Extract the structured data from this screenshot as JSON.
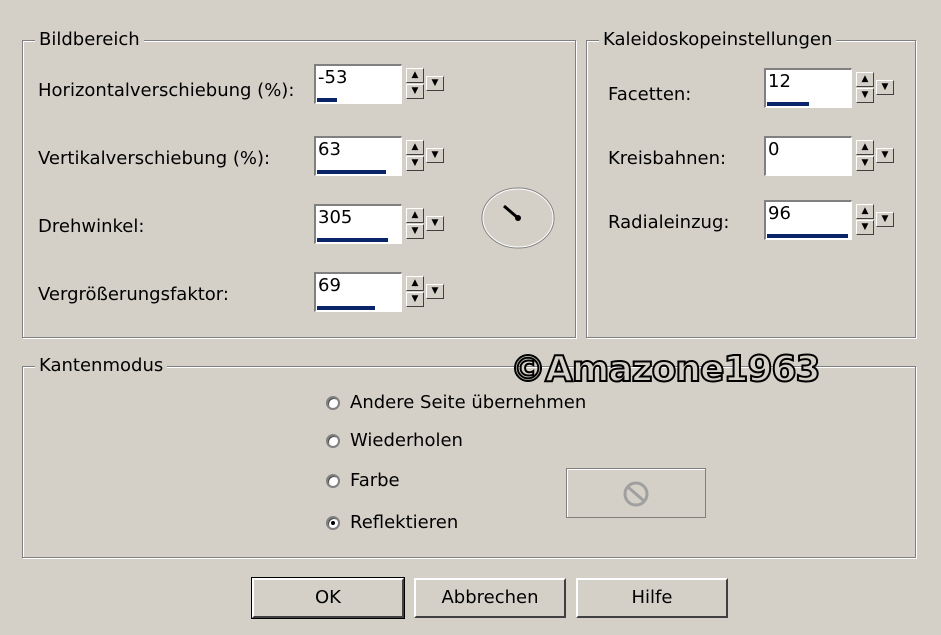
{
  "bildbereich": {
    "title": "Bildbereich",
    "horizontal_label": "Horizontalverschiebung (%):",
    "horizontal_value": "-53",
    "horizontal_fill": 0.24,
    "vertikal_label": "Vertikalverschiebung (%):",
    "vertikal_value": "63",
    "vertikal_fill": 0.82,
    "drehwinkel_label": "Drehwinkel:",
    "drehwinkel_value": "305",
    "drehwinkel_fill": 0.85,
    "vergroesserung_label": "Vergrößerungsfaktor:",
    "vergroesserung_value": "69",
    "vergroesserung_fill": 0.69
  },
  "kaleidoskop": {
    "title": "Kaleidoskopeinstellungen",
    "facetten_label": "Facetten:",
    "facetten_value": "12",
    "facetten_fill": 0.5,
    "kreisbahnen_label": "Kreisbahnen:",
    "kreisbahnen_value": "0",
    "kreisbahnen_fill": 0.0,
    "radial_label": "Radialeinzug:",
    "radial_value": "96",
    "radial_fill": 0.96
  },
  "kantenmodus": {
    "title": "Kantenmodus",
    "options": [
      "Andere Seite übernehmen",
      "Wiederholen",
      "Farbe",
      "Reflektieren"
    ],
    "selected_index": 3
  },
  "buttons": {
    "ok": "OK",
    "cancel": "Abbrechen",
    "help": "Hilfe"
  },
  "watermark": "©Amazone1963",
  "arrow_up": "▲",
  "arrow_down": "▼"
}
